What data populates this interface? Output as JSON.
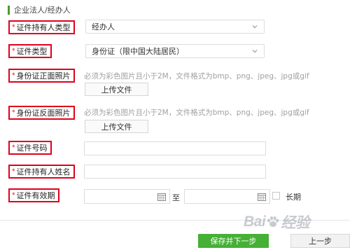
{
  "section": {
    "title": "企业法人/经办人"
  },
  "fields": {
    "holder_type": {
      "required_mark": "*",
      "label": "证件持有人类型",
      "value": "经办人"
    },
    "id_type": {
      "required_mark": "*",
      "label": "证件类型",
      "value": "身份证（限中国大陆居民）"
    },
    "id_front": {
      "required_mark": "*",
      "label": "身份证正面照片",
      "hint": "必须为彩色图片且小于2M，文件格式为bmp、png、jpeg、jpg或gif",
      "button": "上传文件"
    },
    "id_back": {
      "required_mark": "*",
      "label": "身份证反面照片",
      "hint": "必须为彩色图片且小于2M，文件格式为bmp、png、jpeg、jpg或gif",
      "button": "上传文件"
    },
    "id_number": {
      "required_mark": "*",
      "label": "证件号码",
      "value": ""
    },
    "holder_name": {
      "required_mark": "*",
      "label": "证件持有人姓名",
      "value": ""
    },
    "validity": {
      "required_mark": "*",
      "label": "证件有效期",
      "start": "",
      "to": "至",
      "end": "",
      "long_term": "长期",
      "long_term_checked": false
    }
  },
  "actions": {
    "save_next": "保存并下一步",
    "prev": "上一步"
  },
  "watermark": {
    "text_left": "Bai",
    "text_right": "经验"
  },
  "colors": {
    "accent": "#45b035",
    "highlight": "#e0001b"
  }
}
